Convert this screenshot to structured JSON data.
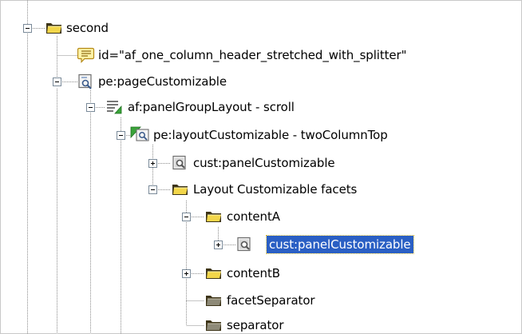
{
  "tree": {
    "nodes": [
      {
        "label": "second",
        "icon": "folder-icon",
        "toggle": "expanded"
      },
      {
        "label": "id=\"af_one_column_header_stretched_with_splitter\"",
        "icon": "comment-icon",
        "toggle": "none"
      },
      {
        "label": "pe:pageCustomizable",
        "icon": "customizable-component-icon",
        "toggle": "expanded"
      },
      {
        "label": "af:panelGroupLayout - scroll",
        "icon": "panel-group-layout-icon",
        "toggle": "expanded"
      },
      {
        "label": "pe:layoutCustomizable - twoColumnTop",
        "icon": "layout-customizable-icon",
        "toggle": "expanded"
      },
      {
        "label": "cust:panelCustomizable",
        "icon": "customizable-component-icon",
        "toggle": "collapsed"
      },
      {
        "label": "Layout Customizable facets",
        "icon": "folder-icon",
        "toggle": "expanded"
      },
      {
        "label": "contentA",
        "icon": "folder-icon",
        "toggle": "expanded"
      },
      {
        "label": "cust:panelCustomizable",
        "icon": "customizable-component-icon",
        "toggle": "collapsed",
        "selected": true
      },
      {
        "label": "contentB",
        "icon": "folder-icon",
        "toggle": "collapsed"
      },
      {
        "label": "facetSeparator",
        "icon": "folder-icon",
        "toggle": "none"
      },
      {
        "label": "separator",
        "icon": "folder-icon",
        "toggle": "none"
      }
    ]
  },
  "colors": {
    "selection": "#2a5fc4",
    "folder_dark": "#3d3418",
    "folder_yellow": "#f2d64a",
    "connector": "#8c8c8c"
  }
}
